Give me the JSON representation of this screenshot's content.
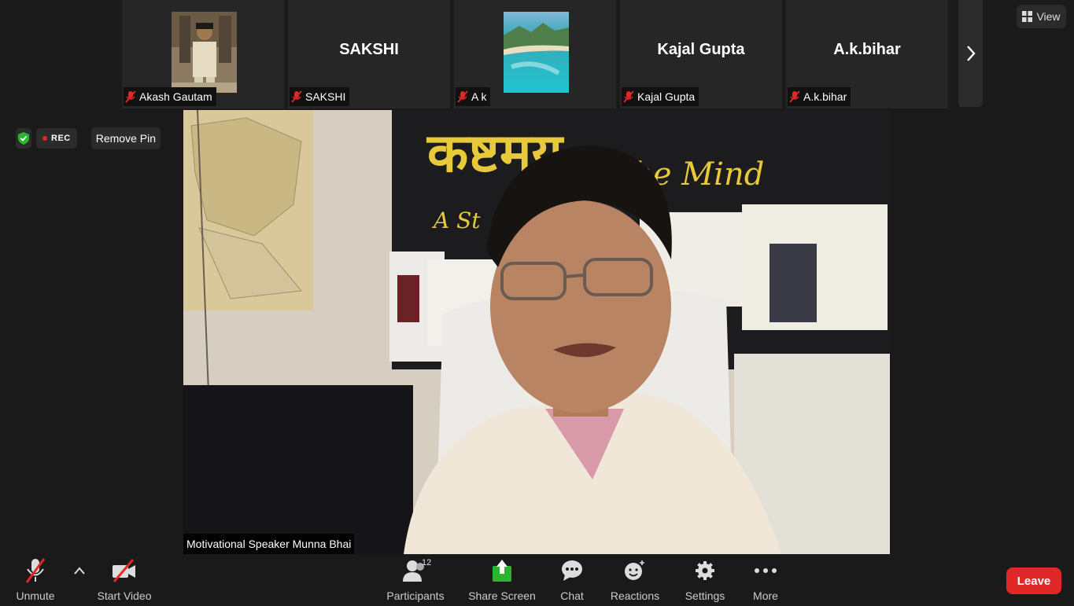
{
  "participants_strip": [
    {
      "name": "Akash Gautam",
      "label": "Akash Gautam",
      "type": "photo"
    },
    {
      "name": "SAKSHI",
      "label": "SAKSHI",
      "type": "name"
    },
    {
      "name": "A k",
      "label": "A k",
      "type": "photo-landscape"
    },
    {
      "name": "Kajal Gupta",
      "label": "Kajal Gupta",
      "type": "name"
    },
    {
      "name": "A.k.bihar",
      "label": "A.k.bihar",
      "type": "name"
    }
  ],
  "view_label": "View",
  "rec_label": "REC",
  "remove_pin_label": "Remove Pin",
  "main_video": {
    "speaker_name": "Motivational Speaker Munna Bhai",
    "banner_text_hindi": "कष्टमय",
    "banner_text_english": "the Mind",
    "banner_text_script": "A St"
  },
  "toolbar": {
    "unmute_label": "Unmute",
    "start_video_label": "Start Video",
    "participants_label": "Participants",
    "participants_count": "12",
    "share_screen_label": "Share Screen",
    "chat_label": "Chat",
    "reactions_label": "Reactions",
    "settings_label": "Settings",
    "more_label": "More",
    "leave_label": "Leave"
  },
  "colors": {
    "background": "#1a1a1a",
    "tile": "#262626",
    "leave": "#e02828",
    "share": "#2bb52f",
    "shield": "#2bb52f",
    "mic_off": "#e02828"
  }
}
